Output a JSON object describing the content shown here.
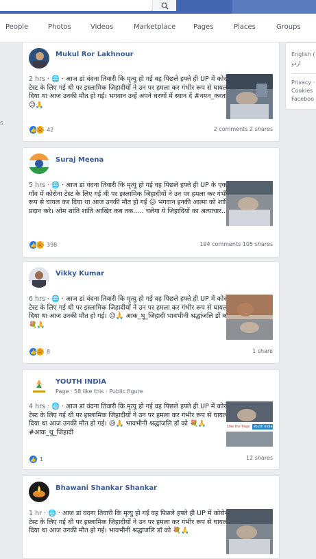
{
  "colors": {
    "brand": "#4267b2",
    "link": "#385898",
    "like": "#1877f2",
    "sad": "#f7b125"
  },
  "topbar": {
    "search_icon": "search-icon"
  },
  "nav": [
    "People",
    "Photos",
    "Videos",
    "Marketplace",
    "Pages",
    "Places",
    "Groups"
  ],
  "sidebar_right": {
    "language": "English (",
    "language2": "اردو",
    "links": [
      "Privacy ·",
      "Cookies",
      "Faceboo"
    ]
  },
  "left_marker": "s",
  "posts": [
    {
      "author": "Mukul Ror Lakhnour",
      "time": "2 hrs ·",
      "text": "आज डां वंदना तिवारी कि मृत्यु हो गई वह पिछले हफ्ते ही UP में कोरोना टेस्ट के लिए गई थी पर इस्लामिक जिहादीयों ने उन पर हमला कर गंभीर रूप से घायल कर दिया था आज उनकी मौत हो गई। भगवान उन्हें अपने चरणों में स्थान दें #नमन_करता_हूँ 😥🙏",
      "reaction_count": "42",
      "stats": "2 comments  2 shares"
    },
    {
      "author": "Suraj Meena",
      "time": "5 hrs ·",
      "text": "आज डां वंदना तिवारी कि मृत्यु हो गई वह पिछले हफ्ते ही UP के एक गाँव में कोरोना टेस्ट के लिए गई थी पर इस्लामिक जिहादीयों ने उन पर हमला कर गंभीर रूप से घायल कर दिया था आज उनकी मौत हो गई 😥 भगवान इनकी आत्मा को शांति प्रदान करे। ओम शांति शांति आखिर कब तक..... चलेगा ये जिहादियों का अत्याचार.....!",
      "reaction_count": "398",
      "stats": "194 comments  105 shares"
    },
    {
      "author": "Vikky Kumar",
      "time": "6 hrs ·",
      "text": "आज डां वंदना तिवारी कि मृत्यु हो गई वह पिछले हफ्ते ही UP में कोरोना टेस्ट के लिए गई थी पर इस्लामिक जिहादीयों ने उन पर हमला कर गंभीर रूप से घायल कर दिया था आज उनकी मौत हो गई। 😥🙏 आक_थु_जिहादी भावभीनी श्रद्धांजलि डॉ को 💐🙏",
      "reaction_count": "8",
      "stats": "1 share"
    },
    {
      "author": "YOUTH INDIA",
      "time": "4 hrs ·",
      "subline": "Page · 58 like this · Public figure",
      "text": "आज डां वंदना तिवारी कि मृत्यु हो गई वह पिछले हफ्ते ही UP में कोरोना टेस्ट के लिए गई थी पर इस्लामिक जिहादीयों ने उन पर हमला कर गंभीर रूप से घायल कर दिया था आज उनकी मौत हो गई। 😥🙏 भावभीनी श्रद्धांजलि डॉ को 💐🙏 #आक_थु_जिहादी",
      "reaction_count": "1",
      "stats": "12 shares",
      "thumb_caption1": "Like the Page",
      "thumb_caption2": "Youth India"
    },
    {
      "author": "Bhawani Shankar Shankar",
      "time": "1 hr ·",
      "text": "आज डां वंदना तिवारी कि मृत्यु हो गई वह पिछले हफ्ते ही UP में कोरोना टेस्ट के लिए गई थी पर इस्लामिक जिहादीयों ने उन पर हमला कर गंभीर रूप से घायल कर दिया था आज उनकी मौत हो गई। भावभीनी श्रद्धांजलि डॉ को 💐🙏"
    }
  ]
}
